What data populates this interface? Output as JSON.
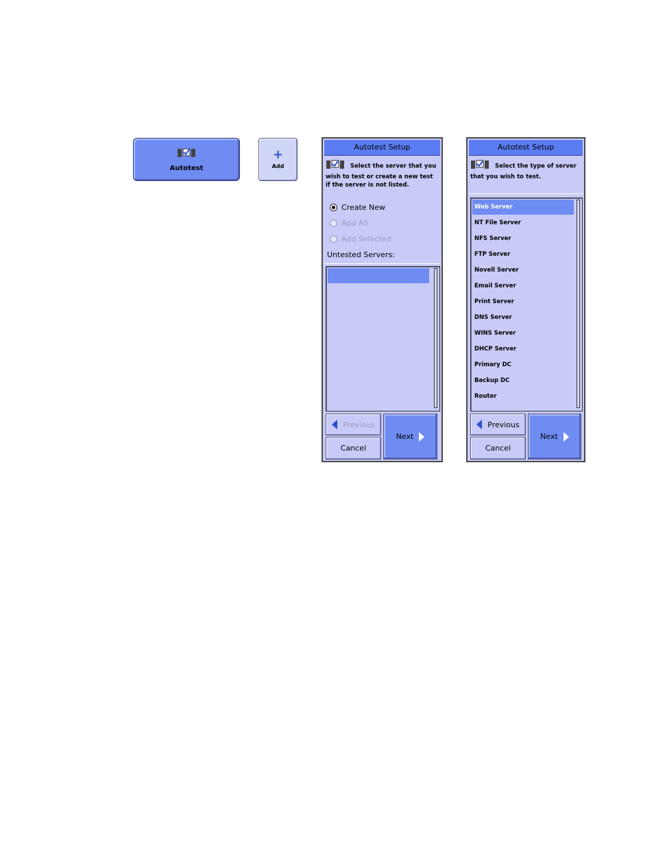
{
  "toolbar": {
    "autotest_label": "Autotest",
    "add_label": "Add",
    "add_glyph": "+"
  },
  "panel1": {
    "title": "Autotest Setup",
    "instruction": "Select the server that you wish to test or create a new test if the server is not listed.",
    "options": [
      {
        "label": "Create New",
        "selected": true,
        "enabled": true
      },
      {
        "label": "Add All",
        "selected": false,
        "enabled": false
      },
      {
        "label": "Add Selected",
        "selected": false,
        "enabled": false
      }
    ],
    "list_label": "Untested Servers:",
    "previous_label": "Previous",
    "next_label": "Next",
    "cancel_label": "Cancel"
  },
  "panel2": {
    "title": "Autotest Setup",
    "instruction": "Select the type of server that you wish to test.",
    "server_types": [
      "Web Server",
      "NT File Server",
      "NFS Server",
      "FTP Server",
      "Novell Server",
      "Email Server",
      "Print Server",
      "DNS Server",
      "WINS Server",
      "DHCP Server",
      "Primary DC",
      "Backup DC",
      "Router"
    ],
    "selected_index": 0,
    "previous_label": "Previous",
    "next_label": "Next",
    "cancel_label": "Cancel"
  },
  "colors": {
    "accent": "#6f8cf2",
    "panel_bg": "#c8cbf7",
    "title_bar": "#5b7cf2",
    "arrow": "#2d4fd0"
  }
}
